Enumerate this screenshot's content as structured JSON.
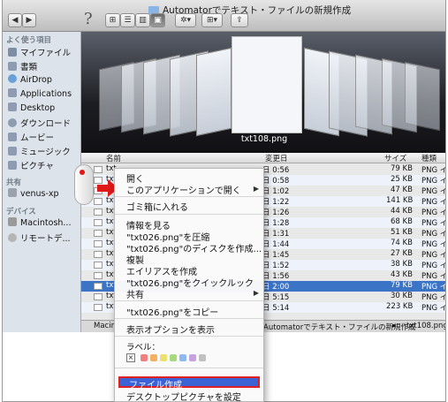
{
  "window": {
    "title": "Automatorでテキスト・ファイルの新規作成"
  },
  "toolbar": {
    "back_label": "◀",
    "forward_label": "▶",
    "help_label": "?",
    "view_icon_label": "⊞",
    "view_list_label": "☰",
    "view_column_label": "▥",
    "view_coverflow_label": "▣",
    "action_label": "✲▾",
    "arrange_label": "⊞▾",
    "share_label": "⇪"
  },
  "sidebar": {
    "favorites_heading": "よく使う項目",
    "favorites": [
      {
        "label": "マイファイル",
        "color": "#7d8da3"
      },
      {
        "label": "書類",
        "color": "#8e9bb0"
      },
      {
        "label": "AirDrop",
        "color": "#6aa0d8"
      },
      {
        "label": "Applications",
        "color": "#8e9bb0"
      },
      {
        "label": "Desktop",
        "color": "#8e9bb0"
      },
      {
        "label": "ダウンロード",
        "color": "#8e9bb0"
      },
      {
        "label": "ムービー",
        "color": "#8e9bb0"
      },
      {
        "label": "ミュージック",
        "color": "#8e9bb0"
      },
      {
        "label": "ピクチャ",
        "color": "#8e9bb0"
      }
    ],
    "shared_heading": "共有",
    "shared": [
      {
        "label": "venus-xp"
      }
    ],
    "devices_heading": "デバイス",
    "devices": [
      {
        "label": "Macintosh..."
      },
      {
        "label": "リモートデ..."
      }
    ]
  },
  "coverflow": {
    "current_label": "txt108.png"
  },
  "list": {
    "columns": {
      "name": "名前",
      "modified": "変更日",
      "size": "サイズ",
      "kind": "種類"
    },
    "rows": [
      {
        "name": "txt",
        "modified": "日 0:56",
        "size": "79 KB",
        "kind": "PNG イ"
      },
      {
        "name": "txt",
        "modified": "日 0:58",
        "size": "25 KB",
        "kind": "PNG イ"
      },
      {
        "name": "txt",
        "modified": "日 1:02",
        "size": "47 KB",
        "kind": "PNG イ"
      },
      {
        "name": "txt",
        "modified": "日 1:22",
        "size": "141 KB",
        "kind": "PNG イ"
      },
      {
        "name": "txt",
        "modified": "日 1:26",
        "size": "44 KB",
        "kind": "PNG イ"
      },
      {
        "name": "txt",
        "modified": "日 1:28",
        "size": "68 KB",
        "kind": "PNG イ"
      },
      {
        "name": "txt",
        "modified": "日 1:31",
        "size": "51 KB",
        "kind": "PNG イ"
      },
      {
        "name": "txt",
        "modified": "日 1:44",
        "size": "74 KB",
        "kind": "PNG イ"
      },
      {
        "name": "txt",
        "modified": "日 1:45",
        "size": "27 KB",
        "kind": "PNG イ"
      },
      {
        "name": "txt",
        "modified": "日 1:52",
        "size": "38 KB",
        "kind": "PNG イ"
      },
      {
        "name": "txt",
        "modified": "日 1:56",
        "size": "43 KB",
        "kind": "PNG イ"
      },
      {
        "name": "txt",
        "modified": "日 2:00",
        "size": "79 KB",
        "kind": "PNG イ"
      },
      {
        "name": "txt",
        "modified": "日 5:15",
        "size": "30 KB",
        "kind": "PNG イ"
      },
      {
        "name": "txt",
        "modified": "日 5:14",
        "size": "223 KB",
        "kind": "PNG イ"
      }
    ]
  },
  "pathbar": {
    "start": "Macin",
    "folder": "Automatorでテキスト・ファイルの新規作成",
    "sep": "▸",
    "file": "txt108.png"
  },
  "context_menu": {
    "open": "開く",
    "open_with": "このアプリケーションで開く",
    "trash": "ゴミ箱に入れる",
    "get_info": "情報を見る",
    "compress": "\"txt026.png\"を圧縮",
    "burn": "\"txt026.png\"のディスクを作成...",
    "duplicate": "複製",
    "alias": "エイリアスを作成",
    "quicklook": "\"txt026.png\"をクイックルック",
    "share": "共有",
    "copy": "\"txt026.png\"をコピー",
    "view_options": "表示オプションを表示",
    "label_heading": "ラベル：",
    "label_none": "×",
    "label_colors": [
      "#f08080",
      "#f4b060",
      "#eee070",
      "#a8d880",
      "#90b8f0",
      "#c8a0e0",
      "#c0c0c0"
    ],
    "create_file": "ファイル作成",
    "set_desktop": "デスクトップピクチャを設定",
    "submenu_arrow": "▶"
  }
}
